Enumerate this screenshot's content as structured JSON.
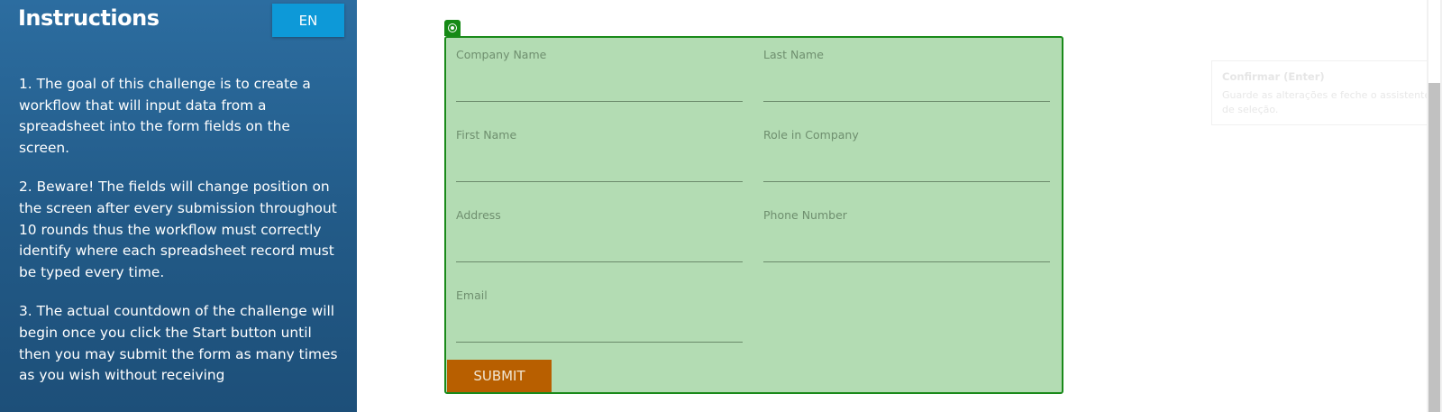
{
  "sidebar": {
    "title": "Instructions",
    "language_button": "EN",
    "instructions": [
      "1. The goal of this challenge is to create a workflow that will input data from a spreadsheet into the form fields on the screen.",
      "2. Beware! The fields will change position on the screen after every submission throughout 10 rounds thus the workflow must correctly identify where each spreadsheet record must be typed every time.",
      "3. The actual countdown of the challenge will begin once you click the Start button until then you may submit the form as many times as you wish without receiving"
    ]
  },
  "form": {
    "fields": {
      "company_name": {
        "label": "Company Name",
        "value": ""
      },
      "last_name": {
        "label": "Last Name",
        "value": ""
      },
      "first_name": {
        "label": "First Name",
        "value": ""
      },
      "role_in_company": {
        "label": "Role in Company",
        "value": ""
      },
      "address": {
        "label": "Address",
        "value": ""
      },
      "phone_number": {
        "label": "Phone Number",
        "value": ""
      },
      "email": {
        "label": "Email",
        "value": ""
      }
    },
    "submit_label": "SUBMIT",
    "anchor_icon": "target-icon"
  },
  "tooltip": {
    "title": "Confirmar (Enter)",
    "body": "Guarde as alterações e feche o assistente de seleção."
  },
  "colors": {
    "sidebar_bg": "#225a87",
    "language_button": "#0d99d8",
    "form_bg": "#b3dcb3",
    "form_border": "#1a8a1a",
    "submit_bg": "#b85f00"
  }
}
